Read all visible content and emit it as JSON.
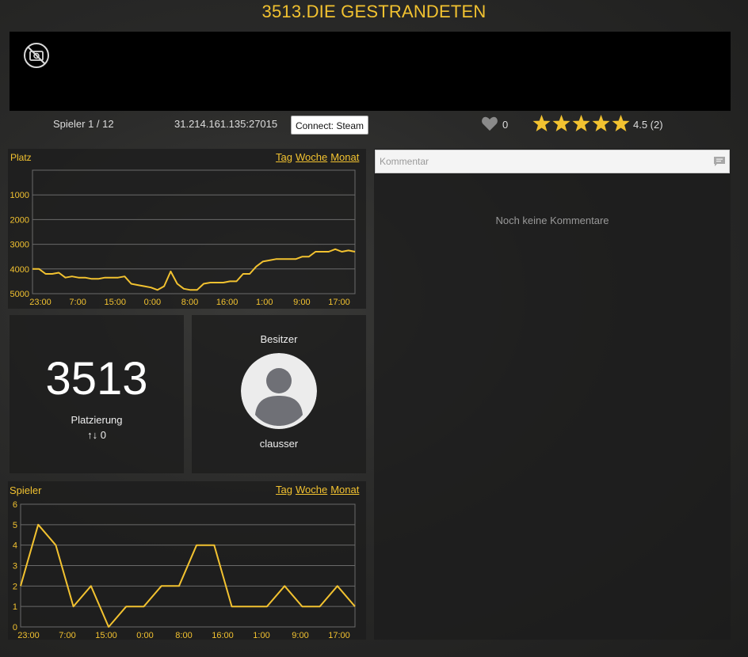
{
  "server": {
    "title": "3513.DIE GESTRANDETEN",
    "players_text": "Spieler 1 / 12",
    "address": "31.214.161.135:27015",
    "connect_label": "Connect: Steam",
    "likes": "0",
    "rating_text": "4.5 (2)",
    "stars": 5
  },
  "banner": {
    "icon": "no-image-icon"
  },
  "rank_chart": {
    "title": "Platz",
    "links": [
      "Tag",
      "Woche",
      "Monat"
    ]
  },
  "players_chart": {
    "title": "Spieler",
    "links": [
      "Tag",
      "Woche",
      "Monat"
    ]
  },
  "rank": {
    "value": "3513",
    "label": "Platzierung",
    "change": "↑↓ 0"
  },
  "owner": {
    "label": "Besitzer",
    "name": "clausser",
    "avatar_icon": "default-avatar-icon"
  },
  "comments": {
    "placeholder": "Kommentar",
    "empty_text": "Noch keine Kommentare",
    "icon": "comment-icon"
  },
  "colors": {
    "accent": "#f2c230",
    "panel": "#1c1c1c"
  },
  "chart_data": [
    {
      "type": "line",
      "title": "Platz",
      "x_tick_labels": [
        "23:00",
        "7:00",
        "15:00",
        "0:00",
        "8:00",
        "16:00",
        "1:00",
        "9:00",
        "17:00"
      ],
      "y_tick_labels": [
        "1000",
        "2000",
        "3000",
        "4000",
        "5000"
      ],
      "ylim": [
        5000,
        0
      ],
      "y_inverted": true,
      "grid": true,
      "series": [
        {
          "values": [
            4000,
            4000,
            4200,
            4200,
            4150,
            4350,
            4300,
            4350,
            4350,
            4400,
            4400,
            4350,
            4350,
            4350,
            4300,
            4600,
            4650,
            4700,
            4750,
            4850,
            4700,
            4100,
            4600,
            4800,
            4850,
            4850,
            4600,
            4550,
            4550,
            4550,
            4500,
            4500,
            4200,
            4200,
            3900,
            3700,
            3650,
            3600,
            3600,
            3600,
            3600,
            3500,
            3500,
            3300,
            3300,
            3300,
            3200,
            3300,
            3250,
            3300
          ]
        }
      ]
    },
    {
      "type": "line",
      "title": "Spieler",
      "x_tick_labels": [
        "23:00",
        "7:00",
        "15:00",
        "0:00",
        "8:00",
        "16:00",
        "1:00",
        "9:00",
        "17:00"
      ],
      "y_tick_labels": [
        "0",
        "1",
        "2",
        "3",
        "4",
        "5",
        "6"
      ],
      "ylim": [
        0,
        6
      ],
      "grid": true,
      "series": [
        {
          "values": [
            2,
            5,
            4,
            1,
            2,
            0,
            1,
            1,
            2,
            2,
            4,
            4,
            1,
            1,
            1,
            2,
            1,
            1,
            2,
            1
          ]
        }
      ]
    }
  ]
}
